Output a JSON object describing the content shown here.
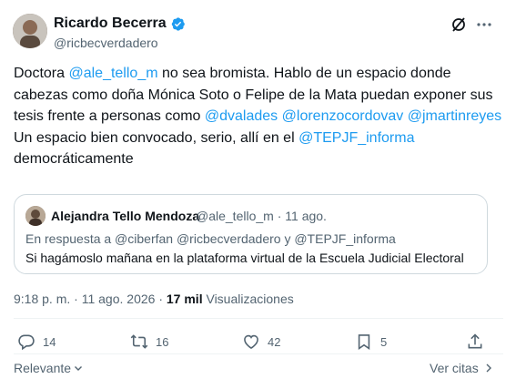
{
  "tweet": {
    "author_name": "Ricardo Becerra",
    "author_handle": "@ricbecverdadero",
    "body": [
      {
        "text": "Doctora ",
        "mention": false
      },
      {
        "text": "@ale_tello_m",
        "mention": true
      },
      {
        "text": " no sea bromista. Hablo de un espacio donde cabezas como doña Mónica Soto o Felipe de la Mata puedan exponer sus tesis frente a personas como ",
        "mention": false
      },
      {
        "text": "@dvalades",
        "mention": true
      },
      {
        "text": " ",
        "mention": false
      },
      {
        "text": "@lorenzocordovav",
        "mention": true
      },
      {
        "text": " ",
        "mention": false
      },
      {
        "text": "@jmartinreyes",
        "mention": true
      },
      {
        "break": true
      },
      {
        "text": "Un espacio bien convocado, serio, allí en el ",
        "mention": false
      },
      {
        "text": "@TEPJF_informa",
        "mention": true
      },
      {
        "text": " democráticamente",
        "mention": false
      }
    ],
    "time": "9:18 p. m.",
    "date": "11 ago. 2026",
    "views_count": "17 mil",
    "views_label": "Visualizaciones"
  },
  "quote": {
    "author_name": "Alejandra Tello Mendoza",
    "author_handle": "@ale_tello_m",
    "date": "11 ago.",
    "reply_line": "En respuesta a @ciberfan @ricbecverdadero y @TEPJF_informa",
    "text": "Si hagámoslo mañana en la plataforma virtual de la Escuela Judicial Electoral"
  },
  "actions": {
    "replies": "14",
    "reposts": "16",
    "likes": "42",
    "bookmarks": "5"
  },
  "footer": {
    "sort_label": "Relevante",
    "quotes_label": "Ver citas"
  },
  "colors": {
    "text": "#0f1419",
    "secondary": "#536471",
    "accent": "#1d9bf0",
    "border": "#cfd9de"
  }
}
